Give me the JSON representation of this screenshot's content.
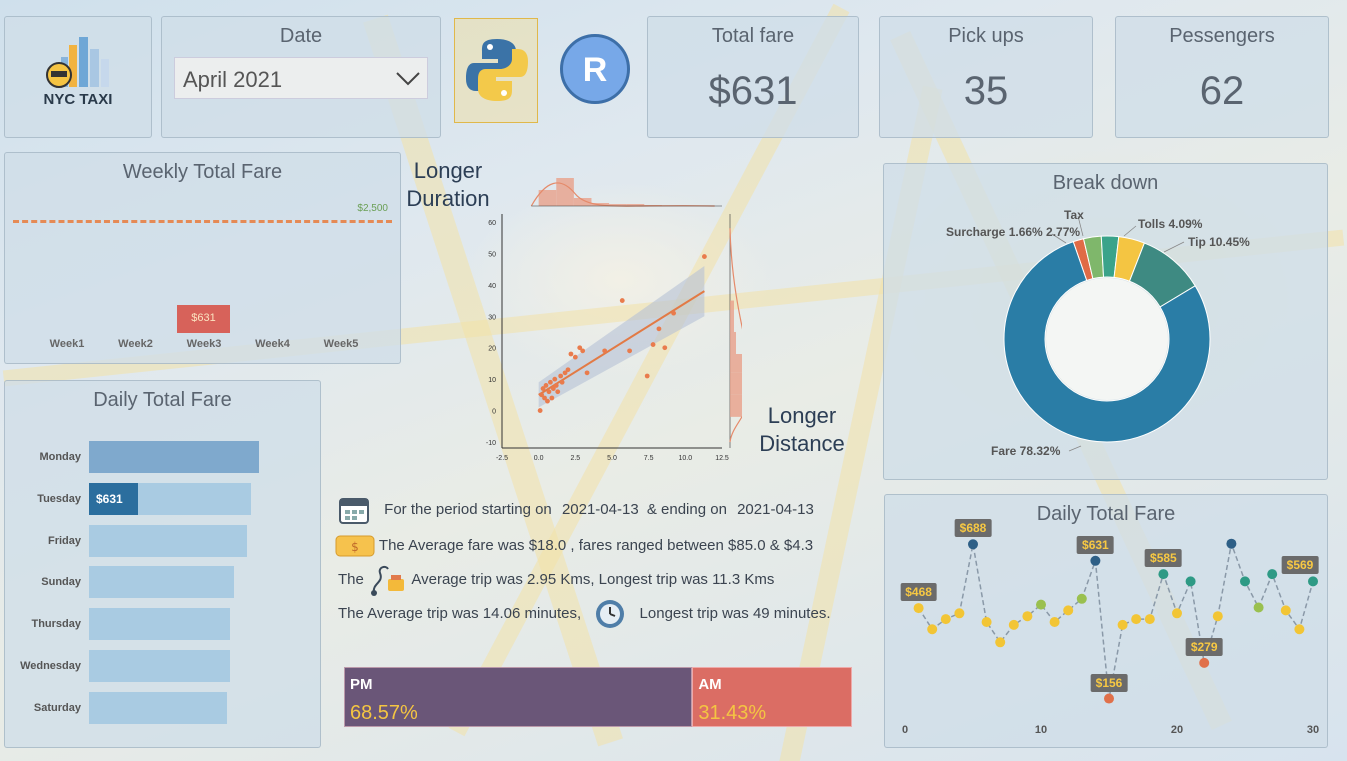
{
  "brand": {
    "logo_text": "NYC TAXI"
  },
  "date_filter": {
    "title": "Date",
    "selected": "April 2021"
  },
  "tools": {
    "python": "python-logo",
    "r": "R"
  },
  "kpis": [
    {
      "title": "Total fare",
      "value": "$631"
    },
    {
      "title": "Pick ups",
      "value": "35"
    },
    {
      "title": "Pessengers",
      "value": "62"
    }
  ],
  "weekly": {
    "title": "Weekly Total Fare",
    "target_label": "$2,500",
    "weeks": [
      "Week1",
      "Week2",
      "Week3",
      "Week4",
      "Week5"
    ],
    "chart_data": {
      "type": "bar",
      "categories": [
        "Week1",
        "Week2",
        "Week3",
        "Week4",
        "Week5"
      ],
      "values": [
        0,
        0,
        631,
        0,
        0
      ],
      "target": 2500,
      "data_label": "$631"
    }
  },
  "daily_bar": {
    "title": "Daily Total Fare",
    "highlight_label": "$631",
    "chart_data": {
      "type": "bar",
      "categories": [
        "Monday",
        "Tuesday",
        "Friday",
        "Sunday",
        "Thursday",
        "Wednesday",
        "Saturday"
      ],
      "values": [
        1.0,
        0.95,
        0.93,
        0.85,
        0.83,
        0.83,
        0.81
      ],
      "highlight": {
        "category": "Tuesday",
        "value": 631,
        "fraction": 0.29
      }
    }
  },
  "scatter": {
    "label_top_1": "Longer",
    "label_top_2": "Duration",
    "label_right_1": "Longer",
    "label_right_2": "Distance",
    "chart_data": {
      "type": "scatter",
      "x_ticks": [
        "-2.5",
        "0.0",
        "2.5",
        "5.0",
        "7.5",
        "10.0",
        "12.5"
      ],
      "y_ticks": [
        "60",
        "50",
        "40",
        "30",
        "20",
        "10",
        "0",
        "-10"
      ],
      "xlim": [
        -2.5,
        12.5
      ],
      "ylim": [
        -10,
        60
      ],
      "points": [
        [
          0.1,
          0
        ],
        [
          0.2,
          5
        ],
        [
          0.3,
          7
        ],
        [
          0.4,
          4
        ],
        [
          0.5,
          8
        ],
        [
          0.6,
          3
        ],
        [
          0.7,
          6
        ],
        [
          0.8,
          9
        ],
        [
          0.9,
          4
        ],
        [
          1.0,
          7
        ],
        [
          1.1,
          10
        ],
        [
          1.2,
          8
        ],
        [
          1.3,
          6
        ],
        [
          1.5,
          11
        ],
        [
          1.6,
          9
        ],
        [
          1.8,
          12
        ],
        [
          2.0,
          13
        ],
        [
          2.2,
          18
        ],
        [
          2.5,
          17
        ],
        [
          2.8,
          20
        ],
        [
          3.0,
          19
        ],
        [
          3.3,
          12
        ],
        [
          4.5,
          19
        ],
        [
          5.7,
          35
        ],
        [
          6.2,
          19
        ],
        [
          7.4,
          11
        ],
        [
          7.8,
          21
        ],
        [
          8.2,
          26
        ],
        [
          8.6,
          20
        ],
        [
          9.2,
          31
        ],
        [
          11.3,
          49
        ]
      ],
      "fit": {
        "x": [
          0,
          11.3
        ],
        "y": [
          5,
          38
        ]
      }
    }
  },
  "breakdown": {
    "title": "Break down",
    "chart_data": {
      "type": "pie",
      "slices": [
        {
          "name": "Fare",
          "value": 78.32,
          "label": "Fare 78.32%",
          "color": "#2a7da6"
        },
        {
          "name": "Surcharge",
          "value": 1.66,
          "label": "Surcharge 1.66%",
          "color": "#e06b46"
        },
        {
          "name": "Tax",
          "value": 2.77,
          "label": "2.77%",
          "color": "#7fb76b"
        },
        {
          "name": "Tolls",
          "value": 2.71,
          "label": "Tolls 4.09%",
          "color": "#3aa38a"
        },
        {
          "name": "Tip",
          "value": 4.09,
          "label": "",
          "color": "#f4c542"
        },
        {
          "name": "Tip2",
          "value": 10.45,
          "label": "Tip 10.45%",
          "color": "#3e8a82"
        }
      ],
      "labels": {
        "fare": "Fare 78.32%",
        "surcharge": "Surcharge 1.66% 2.77%",
        "tax": "Tax",
        "tolls": "Tolls 4.09%",
        "tip": "Tip 10.45%"
      }
    }
  },
  "summary": {
    "line1_a": "For the period starting on",
    "line1_start": "2021-04-13",
    "line1_b": "& ending on",
    "line1_end": "2021-04-13",
    "line2": "The Average fare was $18.0 , fares ranged between $85.0 & $4.3",
    "line3_a": "The",
    "line3_b": "Average trip was 2.95 Kms, Longest trip was 11.3 Kms",
    "line4_a": "The Average trip was 14.06 minutes,",
    "line4_b": "Longest trip was 49 minutes."
  },
  "ampm": {
    "pm_label": "PM",
    "pm_value": "68.57%",
    "am_label": "AM",
    "am_value": "31.43%",
    "chart_data": {
      "type": "bar",
      "categories": [
        "PM",
        "AM"
      ],
      "values": [
        68.57,
        31.43
      ]
    }
  },
  "daily_line": {
    "title": "Daily Total Fare",
    "x_ticks": [
      "0",
      "10",
      "20",
      "30"
    ],
    "chart_data": {
      "type": "line",
      "xlim": [
        0,
        30
      ],
      "ylim": [
        120,
        720
      ],
      "x": [
        1,
        2,
        3,
        4,
        5,
        6,
        7,
        8,
        9,
        10,
        11,
        12,
        13,
        14,
        15,
        16,
        17,
        18,
        19,
        20,
        21,
        22,
        23,
        24,
        25,
        26,
        27,
        28,
        29,
        30
      ],
      "y": [
        468,
        395,
        430,
        450,
        688,
        420,
        350,
        410,
        440,
        480,
        420,
        460,
        500,
        631,
        156,
        410,
        430,
        430,
        585,
        450,
        560,
        279,
        440,
        690,
        560,
        470,
        585,
        460,
        395,
        560
      ],
      "labels": [
        {
          "x": 1,
          "text": "$468"
        },
        {
          "x": 5,
          "text": "$688"
        },
        {
          "x": 14,
          "text": "$631"
        },
        {
          "x": 15,
          "text": "$156"
        },
        {
          "x": 19,
          "text": "$585"
        },
        {
          "x": 22,
          "text": "$279"
        },
        {
          "x": 30,
          "text": "$569"
        }
      ]
    }
  }
}
